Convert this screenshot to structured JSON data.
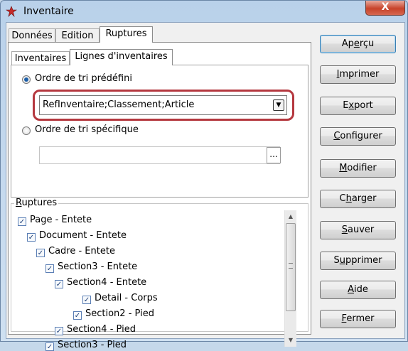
{
  "window": {
    "title": "Inventaire",
    "close_label": "X"
  },
  "tabs": [
    "Données",
    "Edition",
    "Ruptures"
  ],
  "subtabs": [
    "Inventaires",
    "Lignes d'inventaires"
  ],
  "sort": {
    "predefined_label": "Ordre de tri prédéfini",
    "predefined_value": "RefInventaire;Classement;Article",
    "specific_label": "Ordre de tri spécifique",
    "specific_value": "",
    "browse_label": "..."
  },
  "ruptures": {
    "title": "Ruptures",
    "items": [
      {
        "label": "Page - Entete",
        "checked": true
      },
      {
        "label": "Document - Entete",
        "checked": true
      },
      {
        "label": "Cadre - Entete",
        "checked": true
      },
      {
        "label": "Section3 - Entete",
        "checked": true
      },
      {
        "label": "Section4 - Entete",
        "checked": true
      },
      {
        "label": "Detail - Corps",
        "checked": true
      },
      {
        "label": "Section2 - Pied",
        "checked": true
      },
      {
        "label": "Section4 - Pied",
        "checked": true
      },
      {
        "label": "Section3 - Pied",
        "checked": true
      }
    ]
  },
  "buttons": {
    "apercu": {
      "pre": "Ap",
      "u": "e",
      "post": "rçu"
    },
    "imprimer": {
      "pre": "",
      "u": "I",
      "post": "mprimer"
    },
    "export": {
      "pre": "E",
      "u": "x",
      "post": "port"
    },
    "configurer": {
      "pre": "",
      "u": "C",
      "post": "onfigurer"
    },
    "modifier": {
      "pre": "",
      "u": "M",
      "post": "odifier"
    },
    "charger": {
      "pre": "C",
      "u": "h",
      "post": "arger"
    },
    "sauver": {
      "pre": "",
      "u": "S",
      "post": "auver"
    },
    "supprimer": {
      "pre": "S",
      "u": "u",
      "post": "pprimer"
    },
    "aide": {
      "pre": "",
      "u": "A",
      "post": "ide"
    },
    "fermer": {
      "pre": "",
      "u": "F",
      "post": "ermer"
    }
  }
}
